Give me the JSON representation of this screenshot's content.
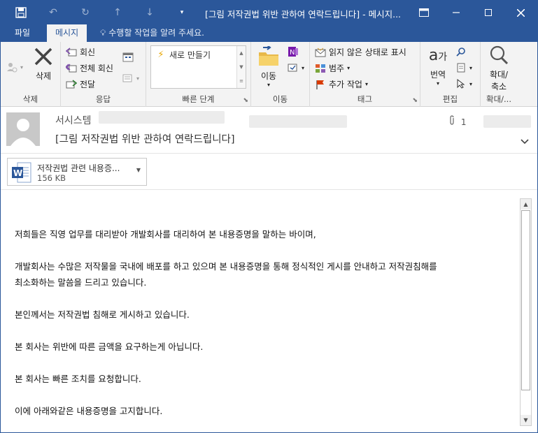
{
  "titlebar": {
    "title": "[그림 저작권법 위반 관하여 연락드립니다] - 메시지...",
    "save_icon": "save-icon",
    "undo_icon": "undo-icon",
    "redo_icon": "redo-icon",
    "up_icon": "up-arrow-icon",
    "down_icon": "down-arrow-icon",
    "customize_icon": "customize-qat-icon"
  },
  "tabs": [
    {
      "label": "파일"
    },
    {
      "label": "메시지"
    }
  ],
  "tellme": "수행할 작업을 알려 주세요.",
  "ribbon": {
    "delete": {
      "label": "삭제",
      "group": "삭제"
    },
    "respond": {
      "reply": "회신",
      "reply_all": "전체 회신",
      "forward": "전달",
      "group": "응답"
    },
    "quicksteps": {
      "new": "새로 만들기",
      "group": "빠른 단계"
    },
    "move": {
      "label": "이동",
      "group": "이동"
    },
    "tags": {
      "unread": "읽지 않은 상태로 표시",
      "categorize": "범주",
      "followup": "추가 작업",
      "group": "태그"
    },
    "editing": {
      "translate": "번역",
      "group": "편집"
    },
    "zoom": {
      "label": "확대/\n축소",
      "label1": "확대/",
      "label2": "축소",
      "group": "확대/..."
    }
  },
  "header": {
    "sender": "서시스템",
    "subject": "[그림 저작권법 위반 관하여 연락드립니다]",
    "attachment_count": "1"
  },
  "attachment": {
    "name": "저작권법 관련 내용증...",
    "size": "156 KB"
  },
  "body": [
    "저희들은 직영 업무를 대리받아 개발회사를 대리하여 본 내용증명을 말하는 바이며,",
    "개발회사는 수많은 저작물을 국내에 배포를 하고 있으며 본 내용증명을 통해 정식적인 게시를 안내하고 저작권침해를",
    "최소화하는 말씀을 드리고 있습니다.",
    "본인께서는 저작권법 침해로 게시하고 있습니다.",
    "본 회사는 위반에 따른  금액을 요구하는게 아닙니다.",
    "본 회사는 빠른 조치를 요청합니다.",
    "이에 아래와같은 내용증명을 고지합니다."
  ],
  "colors": {
    "accent": "#2b579a",
    "ribbon_bg": "#f3f3f3"
  }
}
